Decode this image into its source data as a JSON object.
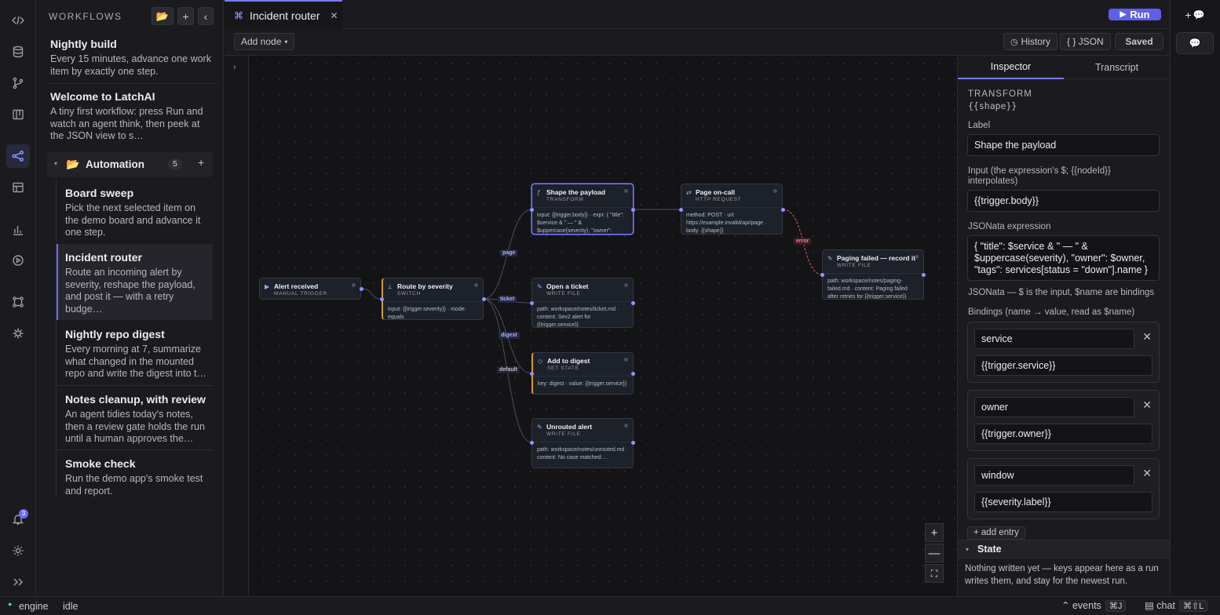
{
  "sidebar": {
    "header": "WORKFLOWS",
    "collapse_glyph": "‹",
    "items": [
      {
        "title": "Nightly build",
        "desc": "Every 15 minutes, advance one work item by exactly one step."
      },
      {
        "title": "Welcome to LatchAI",
        "desc": "A tiny first workflow: press Run and watch an agent think, then peek at the JSON view to s…"
      }
    ],
    "folder": {
      "name": "Automation",
      "count": "5"
    },
    "children": [
      {
        "title": "Board sweep",
        "desc": "Pick the next selected item on the demo board and advance it one step."
      },
      {
        "title": "Incident router",
        "desc": "Route an incoming alert by severity, reshape the payload, and post it — with a retry budge…"
      },
      {
        "title": "Nightly repo digest",
        "desc": "Every morning at 7, summarize what changed in the mounted repo and write the digest into t…"
      },
      {
        "title": "Notes cleanup, with review",
        "desc": "An agent tidies today's notes, then a review gate holds the run until a human approves the…"
      },
      {
        "title": "Smoke check",
        "desc": "Run the demo app's smoke test and report."
      }
    ]
  },
  "rail": {
    "notifications": "3"
  },
  "tab": {
    "title": "Incident router"
  },
  "header": {
    "run_label": "Run"
  },
  "toolbar": {
    "add_node": "Add node",
    "history": "History",
    "json": "{ } JSON",
    "saved": "Saved"
  },
  "graph": {
    "nodes": [
      {
        "title": "Alert received",
        "kind": "MANUAL TRIGGER",
        "body": ""
      },
      {
        "title": "Route by severity",
        "kind": "SWITCH",
        "body": "input: {{trigger.severity}} · mode: equals"
      },
      {
        "title": "Shape the payload",
        "kind": "TRANSFORM",
        "body": "input: {{trigger.body}} · expr: { \"title\": $service & \" — \" & $uppercase(severity), \"owner\":"
      },
      {
        "title": "Page on-call",
        "kind": "HTTP REQUEST",
        "body": "method: POST · url: https://example.invalid/api/page · body: {{shape}}"
      },
      {
        "title": "Open a ticket",
        "kind": "WRITE FILE",
        "body": "path: workspace/notes/ticket.md · content: Sev2 alert for {{trigger.service}}"
      },
      {
        "title": "Add to digest",
        "kind": "SET STATE",
        "body": "key: digest · value: {{trigger.service}}"
      },
      {
        "title": "Unrouted alert",
        "kind": "WRITE FILE",
        "body": "path: workspace/notes/unrouted.md · content: No case matched:…"
      },
      {
        "title": "Paging failed — record it",
        "kind": "WRITE FILE",
        "body": "path: workspace/notes/paging-failed.md · content: Paging failed after retries for {{trigger.service}}"
      }
    ],
    "edge_labels": [
      "page",
      "ticket",
      "digest",
      "default",
      "error"
    ]
  },
  "inspector": {
    "tabs": [
      "Inspector",
      "Transcript"
    ],
    "kind": "TRANSFORM",
    "ref": "{{shape}}",
    "label_label": "Label",
    "label_value": "Shape the payload",
    "input_label": "Input (the expression's $; {{nodeId}} interpolates)",
    "input_value": "{{trigger.body}}",
    "expr_label": "JSONata expression",
    "expr_value": "{ \"title\": $service & \" — \" & $uppercase(severity), \"owner\": $owner, \"tags\": services[status = \"down\"].name }",
    "expr_hint": "JSONata — $ is the input, $name are bindings",
    "bindings_label": "Bindings (name → value, read as $name)",
    "bindings": [
      {
        "name": "service",
        "value": "{{trigger.service}}"
      },
      {
        "name": "owner",
        "value": "{{trigger.owner}}"
      },
      {
        "name": "window",
        "value": "{{severity.label}}"
      }
    ],
    "add_entry": "+ add entry",
    "state_title": "State",
    "state_text": "Nothing written yet — keys appear here as a run writes them, and stay for the newest run."
  },
  "status": {
    "engine": "engine",
    "state": "idle",
    "events": "events",
    "events_kbd": "⌘J",
    "chat": "chat",
    "chat_kbd": "⌘⇧L"
  }
}
